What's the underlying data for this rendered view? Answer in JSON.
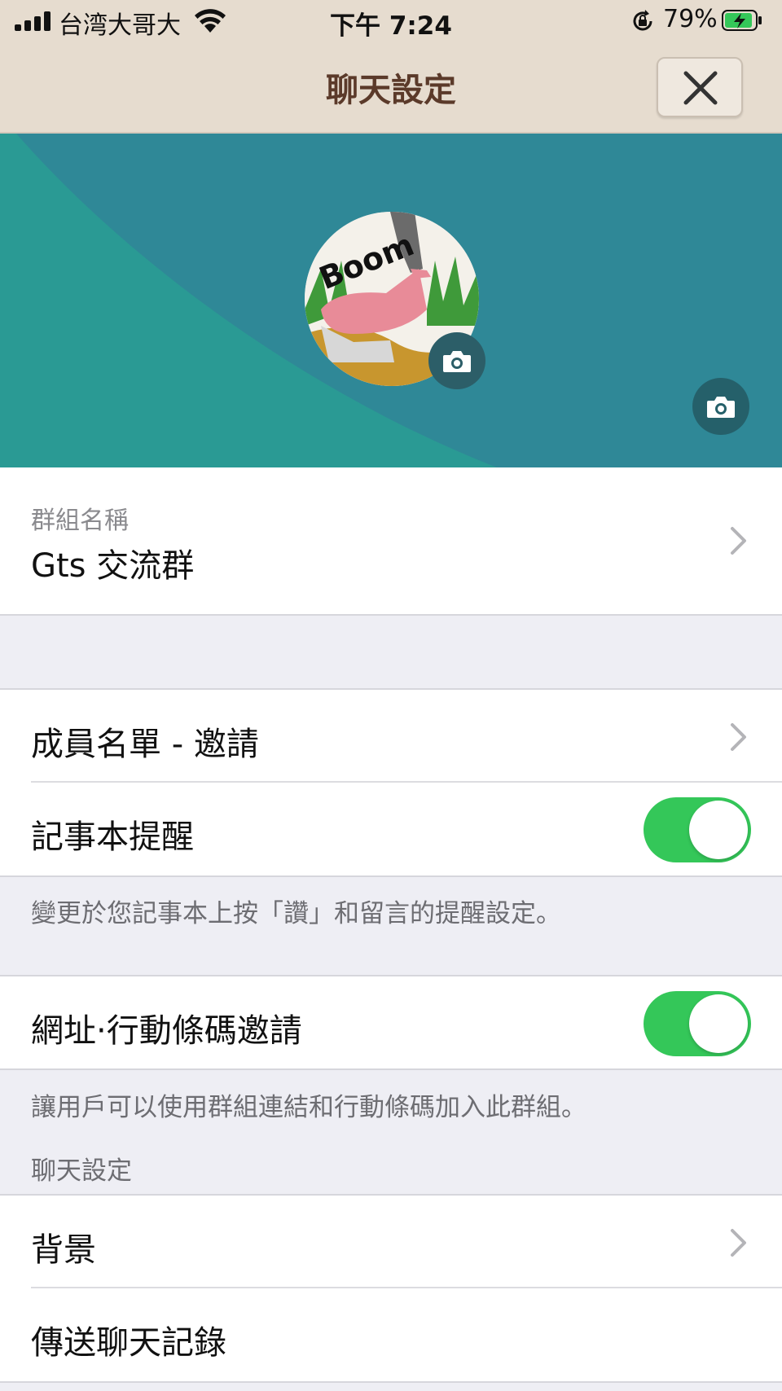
{
  "status_bar": {
    "carrier": "台湾大哥大",
    "time": "下午 7:24",
    "battery": "79%"
  },
  "nav": {
    "title": "聊天設定"
  },
  "colors": {
    "nav_bg": "#e6dccf",
    "title": "#5b3a2a",
    "hero_bg": "#2f8897",
    "toggle_on": "#34c759"
  },
  "group_name": {
    "label": "群組名稱",
    "value": "Gts 交流群"
  },
  "members": {
    "label": "成員名單 - 邀請"
  },
  "notes_reminder": {
    "label": "記事本提醒",
    "enabled": true,
    "description": "變更於您記事本上按「讚」和留言的提醒設定。"
  },
  "url_invite": {
    "label": "網址·行動條碼邀請",
    "enabled": true,
    "description": "讓用戶可以使用群組連結和行動條碼加入此群組。"
  },
  "chat_section": {
    "header": "聊天設定",
    "background_label": "背景",
    "send_history_label": "傳送聊天記錄"
  },
  "icons": [
    "signal-icon",
    "wifi-icon",
    "rotation-lock-icon",
    "battery-icon",
    "close-icon",
    "camera-icon",
    "chevron-right-icon"
  ]
}
